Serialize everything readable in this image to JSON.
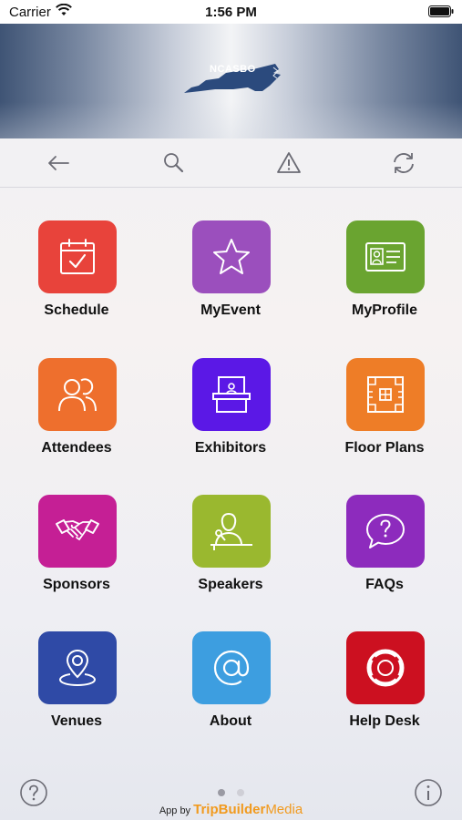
{
  "status_bar": {
    "carrier": "Carrier",
    "time": "1:56 PM"
  },
  "header": {
    "logo_text": "NCASBO"
  },
  "toolbar": {
    "back_icon": "arrow-left-icon",
    "search_icon": "search-icon",
    "alert_icon": "warning-icon",
    "refresh_icon": "refresh-icon"
  },
  "tiles": [
    {
      "label": "Schedule",
      "color": "#e8433b",
      "icon": "calendar-check-icon"
    },
    {
      "label": "MyEvent",
      "color": "#9b4fbd",
      "icon": "star-icon"
    },
    {
      "label": "MyProfile",
      "color": "#6aa430",
      "icon": "id-card-icon"
    },
    {
      "label": "Attendees",
      "color": "#ee6f2d",
      "icon": "people-icon"
    },
    {
      "label": "Exhibitors",
      "color": "#5b18e6",
      "icon": "booth-icon"
    },
    {
      "label": "Floor Plans",
      "color": "#ee7d27",
      "icon": "floor-plan-icon"
    },
    {
      "label": "Sponsors",
      "color": "#c51f95",
      "icon": "handshake-icon"
    },
    {
      "label": "Speakers",
      "color": "#9ab82f",
      "icon": "speaker-icon"
    },
    {
      "label": "FAQs",
      "color": "#8d2bbd",
      "icon": "question-bubble-icon"
    },
    {
      "label": "Venues",
      "color": "#2f4aa6",
      "icon": "location-pin-icon"
    },
    {
      "label": "About",
      "color": "#3d9ee0",
      "icon": "at-sign-icon"
    },
    {
      "label": "Help Desk",
      "color": "#cc1020",
      "icon": "lifebuoy-icon"
    }
  ],
  "footer": {
    "help_icon": "question-circle-icon",
    "info_icon": "info-circle-icon",
    "page_count": 2,
    "active_page": 1,
    "credit_prefix": "App by",
    "credit_brand": "TripBuilder",
    "credit_brand2": "Media"
  }
}
